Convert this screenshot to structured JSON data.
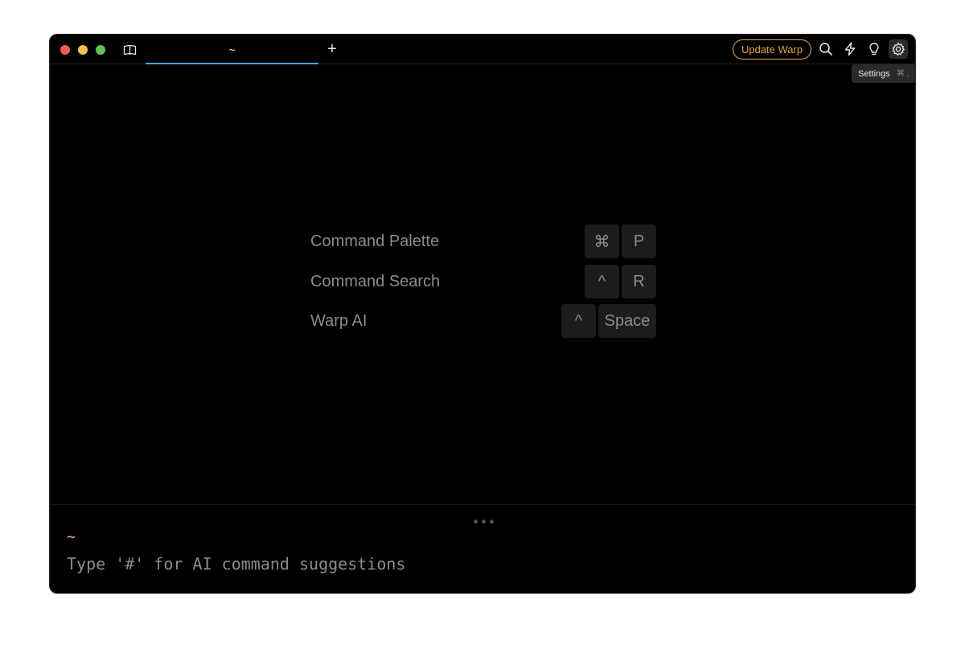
{
  "titlebar": {
    "tab_title": "~",
    "new_tab_label": "+",
    "update_label": "Update Warp",
    "icons": [
      "panel-icon",
      "search-icon",
      "bolt-icon",
      "lightbulb-icon",
      "gear-icon"
    ],
    "tooltip": {
      "label": "Settings",
      "shortcut": "⌘ ,"
    }
  },
  "shortcuts": [
    {
      "label": "Command Palette",
      "keys": [
        "⌘",
        "P"
      ]
    },
    {
      "label": "Command Search",
      "keys": [
        "^",
        "R"
      ]
    },
    {
      "label": "Warp AI",
      "keys": [
        "^",
        "Space"
      ]
    }
  ],
  "input": {
    "directory": "~",
    "placeholder": "Type '#' for AI command suggestions"
  },
  "colors": {
    "accent_tab": "#4aa3df",
    "update_orange": "#e3a43b",
    "prompt_dir": "#d87bd8"
  }
}
